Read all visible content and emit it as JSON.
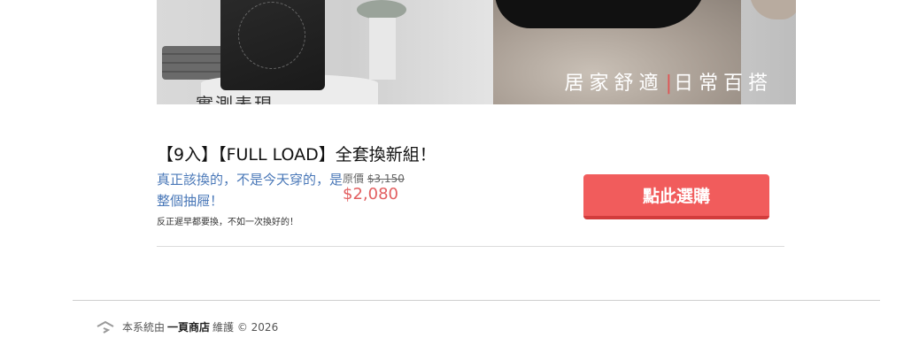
{
  "banner": {
    "caption_left": "居家舒適",
    "caption_right": "日常百搭",
    "corner_text": "實測表現"
  },
  "product": {
    "title": "【9入】【FULL LOAD】全套換新組！",
    "tagline": "真正該換的，不是今天穿的，是整個抽屜！",
    "subnote": "反正遲早都要換，不如一次換好的！",
    "original_label": "原價",
    "original_price": "$3,150",
    "sale_price": "$2,080",
    "buy_button": "點此選購"
  },
  "footer": {
    "prefix": "本系統由",
    "brand": "一頁商店",
    "suffix": "維護 © 2026"
  },
  "colors": {
    "accent": "#f15c5c",
    "price": "#e25f60",
    "tagline": "#4a78b8"
  }
}
